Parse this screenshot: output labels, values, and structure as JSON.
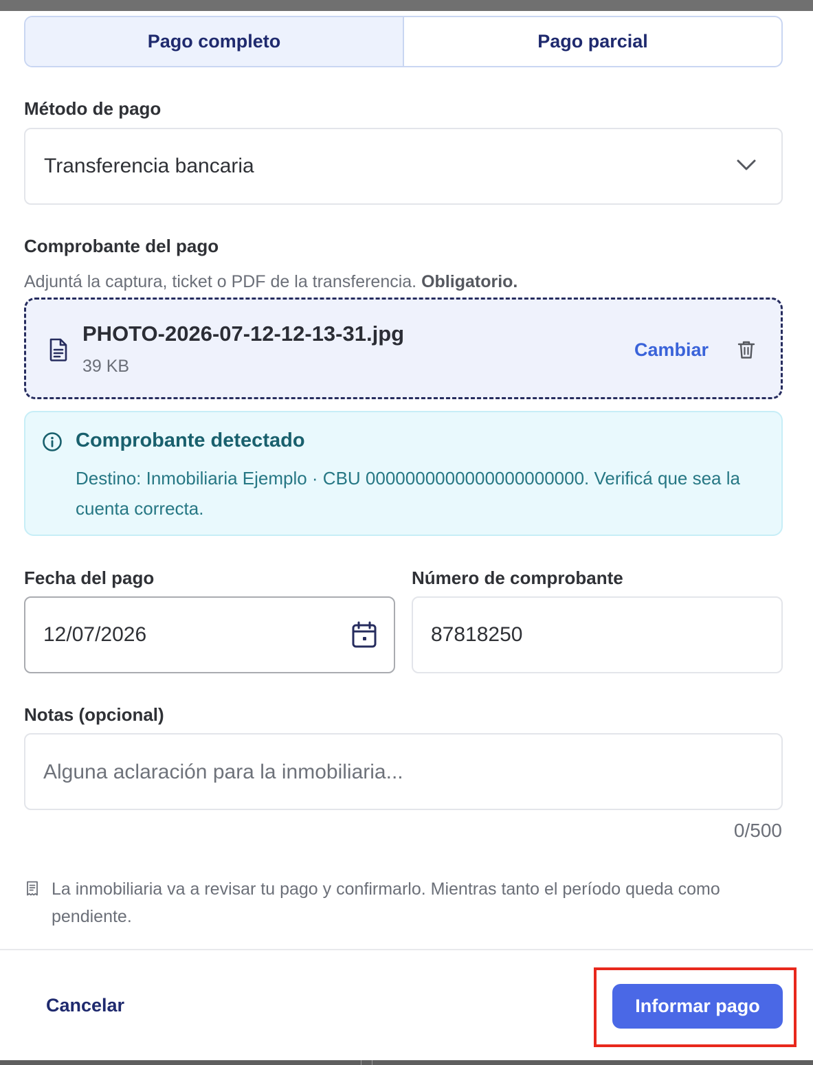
{
  "tabs": [
    {
      "label": "Pago completo",
      "active": true
    },
    {
      "label": "Pago parcial",
      "active": false
    }
  ],
  "payment_method": {
    "label": "Método de pago",
    "selected": "Transferencia bancaria"
  },
  "receipt": {
    "label": "Comprobante del pago",
    "hint": "Adjuntá la captura, ticket o PDF de la transferencia.",
    "hint_required": "Obligatorio.",
    "file_name": "PHOTO-2026-07-12-12-13-31.jpg",
    "file_size": "39 KB",
    "change_label": "Cambiar"
  },
  "alert": {
    "title": "Comprobante detectado",
    "text": "Destino: Inmobiliaria Ejemplo · CBU 0000000000000000000000. Verificá que sea la cuenta correcta."
  },
  "payment_date": {
    "label": "Fecha del pago",
    "value": "12/07/2026"
  },
  "receipt_number": {
    "label": "Número de comprobante",
    "value": "87818250"
  },
  "notes": {
    "label": "Notas (opcional)",
    "placeholder": "Alguna aclaración para la inmobiliaria...",
    "counter": "0/500"
  },
  "info_note": "La inmobiliaria va a revisar tu pago y confirmarlo. Mientras tanto el período queda como pendiente.",
  "footer": {
    "cancel_label": "Cancelar",
    "submit_label": "Informar pago"
  },
  "colors": {
    "accent": "#4a68e6",
    "link": "#3a63d9",
    "navy": "#1f2a6e",
    "alert_bg": "#e9f9fd",
    "highlight": "#e8281c"
  },
  "icons": {
    "select": "chevron-down-icon",
    "file": "document-icon",
    "delete": "trash-icon",
    "alert": "info-icon",
    "date": "calendar-icon",
    "note": "receipt-icon"
  }
}
